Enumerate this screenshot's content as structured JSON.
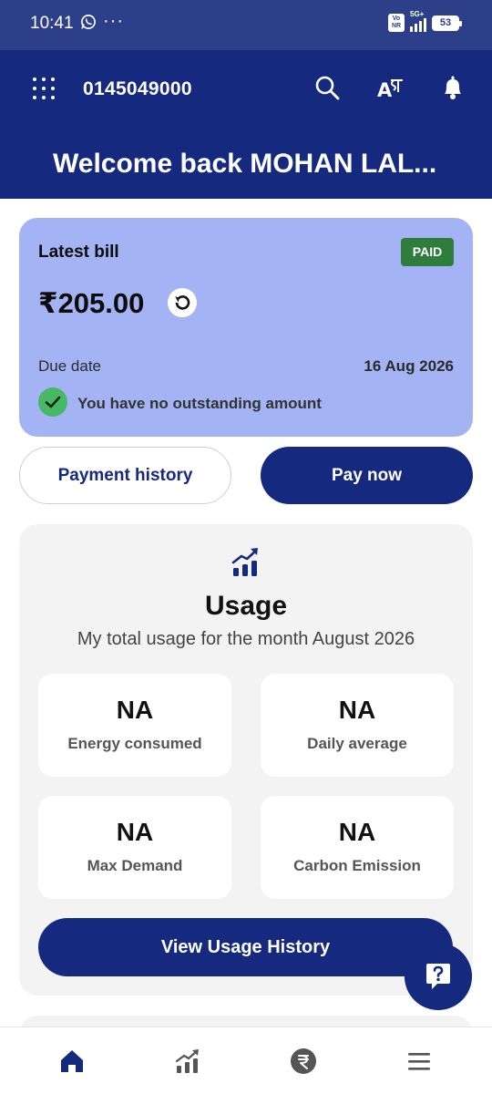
{
  "status_bar": {
    "time": "10:41",
    "more": "···",
    "volte": "Vo NR",
    "network": "5G+",
    "battery": "53"
  },
  "header": {
    "account_number": "0145049000",
    "welcome": "Welcome back MOHAN LAL..."
  },
  "bill": {
    "title": "Latest bill",
    "status_badge": "PAID",
    "amount": "₹205.00",
    "due_label": "Due date",
    "due_date": "16 Aug 2026",
    "outstanding_msg": "You have no outstanding amount"
  },
  "actions": {
    "payment_history": "Payment history",
    "pay_now": "Pay now"
  },
  "usage": {
    "title": "Usage",
    "subtitle": "My total usage for the month August 2026",
    "tiles": [
      {
        "value": "NA",
        "label": "Energy consumed"
      },
      {
        "value": "NA",
        "label": "Daily average"
      },
      {
        "value": "NA",
        "label": "Max Demand"
      },
      {
        "value": "NA",
        "label": "Carbon Emission"
      }
    ],
    "view_history": "View Usage History"
  },
  "bottom_nav": [
    "home-icon",
    "usage-chart-icon",
    "rupee-icon",
    "menu-icon"
  ],
  "colors": {
    "primary": "#15297f",
    "status_bar": "#2d3f88",
    "bill_card": "#a3b3f3",
    "paid_badge": "#2f7d3c",
    "check": "#49b866",
    "surface": "#f3f3f3"
  }
}
